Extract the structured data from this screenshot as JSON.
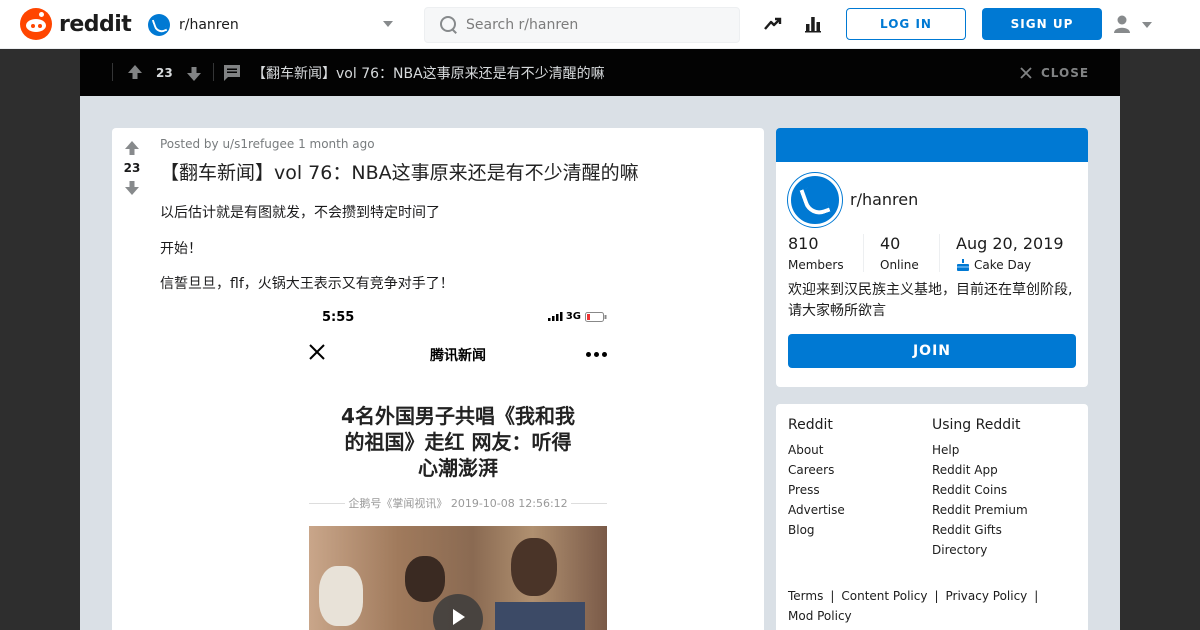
{
  "header": {
    "brand": "reddit",
    "subreddit": "r/hanren",
    "search_placeholder": "Search r/hanren",
    "login_label": "LOG IN",
    "signup_label": "SIGN UP",
    "icons": [
      "trending-icon",
      "stats-icon",
      "user-icon",
      "chevron-down-icon"
    ],
    "brand_color": "#ff4500",
    "accent_color": "#0079d3"
  },
  "postbar": {
    "score": "23",
    "title": "【翻车新闻】vol 76：NBA这事原来还是有不少清醒的嘛",
    "close_label": "CLOSE"
  },
  "post": {
    "score": "23",
    "meta": "Posted by u/s1refugee 1 month ago",
    "title": "【翻车新闻】vol 76：NBA这事原来还是有不少清醒的嘛",
    "paragraphs": [
      "以后估计就是有图就发，不会攒到特定时间了",
      "开始！",
      "信誓旦旦，flf，火锅大王表示又有竞争对手了！"
    ],
    "embed": {
      "time": "5:55",
      "network": "3G",
      "app_title": "腾讯新闻",
      "headline_lines": [
        "4名外国男子共唱《我和我",
        "的祖国》走红 网友：听得",
        "心潮澎湃"
      ],
      "source": "企鹅号《掌闻视讯》 2019-10-08 12:56:12"
    }
  },
  "sidebar": {
    "name": "r/hanren",
    "members": "810",
    "members_label": "Members",
    "online": "40",
    "online_label": "Online",
    "cake_date": "Aug 20, 2019",
    "cake_label": "Cake Day",
    "description": "欢迎来到汉民族主义基地，目前还在草创阶段,请大家畅所欲言",
    "join_label": "JOIN"
  },
  "links": {
    "col1": {
      "title": "Reddit",
      "items": [
        "About",
        "Careers",
        "Press",
        "Advertise",
        "Blog"
      ]
    },
    "col2": {
      "title": "Using Reddit",
      "items": [
        "Help",
        "Reddit App",
        "Reddit Coins",
        "Reddit Premium",
        "Reddit Gifts",
        "Directory"
      ]
    },
    "terms": [
      "Terms",
      "Content Policy",
      "Privacy Policy",
      "Mod Policy"
    ]
  }
}
